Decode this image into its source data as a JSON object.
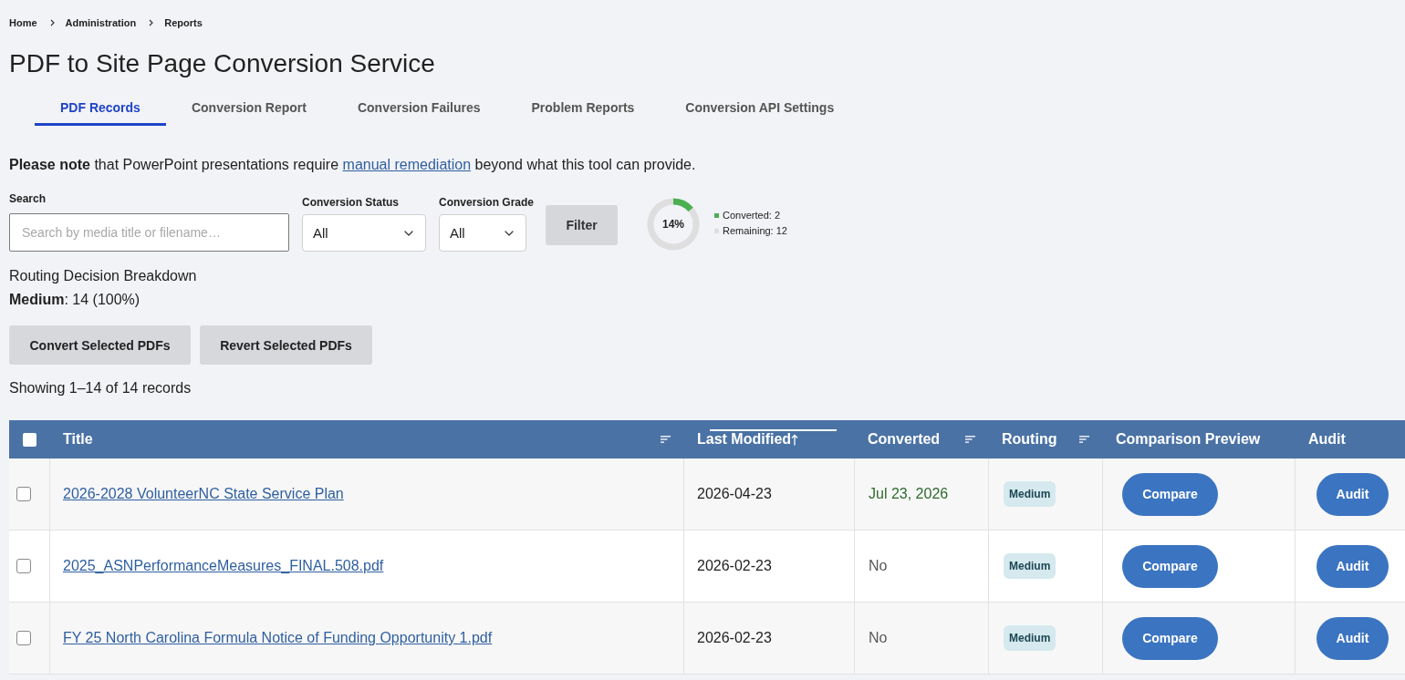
{
  "breadcrumb": [
    "Home",
    "Administration",
    "Reports"
  ],
  "title": "PDF to Site Page Conversion Service",
  "tabs": [
    {
      "label": "PDF Records",
      "selected": true
    },
    {
      "label": "Conversion Report",
      "selected": false
    },
    {
      "label": "Conversion Failures",
      "selected": false
    },
    {
      "label": "Problem Reports",
      "selected": false
    },
    {
      "label": "Conversion API Settings",
      "selected": false
    }
  ],
  "notice": {
    "before": "**Please note** that PowerPoint presentations require ",
    "link": "manual remediation",
    "after": " beyond what this tool can provide."
  },
  "filters": {
    "search": {
      "label": "Search",
      "placeholder": "Search by media title or filename…"
    },
    "status": {
      "label": "Conversion Status",
      "value": "All"
    },
    "grade": {
      "label": "Conversion Grade",
      "value": "All"
    },
    "button": "Filter"
  },
  "progress": {
    "label": "14%",
    "chart_data": {
      "type": "donut",
      "values": [
        14,
        86
      ]
    },
    "legend": [
      {
        "label": "Converted: 2",
        "color": "#4caf50"
      },
      {
        "label": "Remaining: 12",
        "color": "#dedede"
      }
    ]
  },
  "routing_breakdown": {
    "title": "Routing Decision Breakdown",
    "line": "**Medium**: 14 (100%)"
  },
  "actions": [
    "Convert Selected PDFs",
    "Revert Selected PDFs"
  ],
  "summary": "Showing 1–14 of 14 records",
  "table": {
    "select_all": {
      "checked": false
    },
    "columns": [
      {
        "label": "Title",
        "kind": "sortable"
      },
      {
        "label": "Last Modified",
        "kind": "sorted"
      },
      {
        "label": "Converted",
        "kind": "sortable"
      },
      {
        "label": "Routing",
        "kind": "sortable"
      },
      {
        "label": "Comparison Preview",
        "kind": "plain"
      },
      {
        "label": "Audit",
        "kind": "plain"
      }
    ],
    "rows": [
      {
        "checked": false,
        "title": "2026-2028 VolunteerNC State Service Plan",
        "last_modified": "2026-04-23",
        "converted": true,
        "converted_text": "Jul 23, 2026",
        "routing": "Medium",
        "compare": "Compare",
        "audit": "Audit"
      },
      {
        "checked": false,
        "title": "2025_ASNPerformanceMeasures_FINAL.508.pdf",
        "last_modified": "2026-02-23",
        "converted": false,
        "converted_text": "No",
        "routing": "Medium",
        "compare": "Compare",
        "audit": "Audit"
      },
      {
        "checked": false,
        "title": "FY 25 North Carolina Formula Notice of Funding Opportunity 1.pdf",
        "last_modified": "2026-02-23",
        "converted": false,
        "converted_text": "No",
        "routing": "Medium",
        "compare": "Compare",
        "audit": "Audit"
      }
    ]
  }
}
